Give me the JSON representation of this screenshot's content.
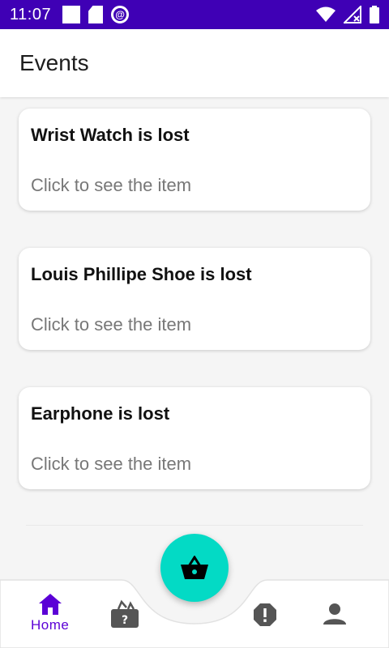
{
  "status_bar": {
    "time": "11:07",
    "icons": [
      "notification-square-icon",
      "sd-card-icon",
      "data-saver-icon",
      "wifi-icon",
      "no-signal-icon",
      "battery-icon"
    ]
  },
  "app_bar": {
    "title": "Events"
  },
  "events": [
    {
      "title": "Wrist Watch is lost",
      "subtitle": "Click to see the item"
    },
    {
      "title": "Louis Phillipe Shoe is lost",
      "subtitle": "Click to see the item"
    },
    {
      "title": "Earphone is lost",
      "subtitle": "Click to see the item"
    }
  ],
  "bottom_nav": {
    "items": [
      {
        "label": "Home",
        "icon": "home-icon",
        "active": true
      },
      {
        "icon": "found-bag-icon"
      },
      {
        "icon": "report-icon"
      },
      {
        "icon": "profile-icon"
      }
    ],
    "fab_icon": "basket-icon"
  },
  "colors": {
    "status_bar": "#3f00b5",
    "accent": "#5b00d6",
    "fab": "#03dac5",
    "inactive_icon": "#555555"
  }
}
